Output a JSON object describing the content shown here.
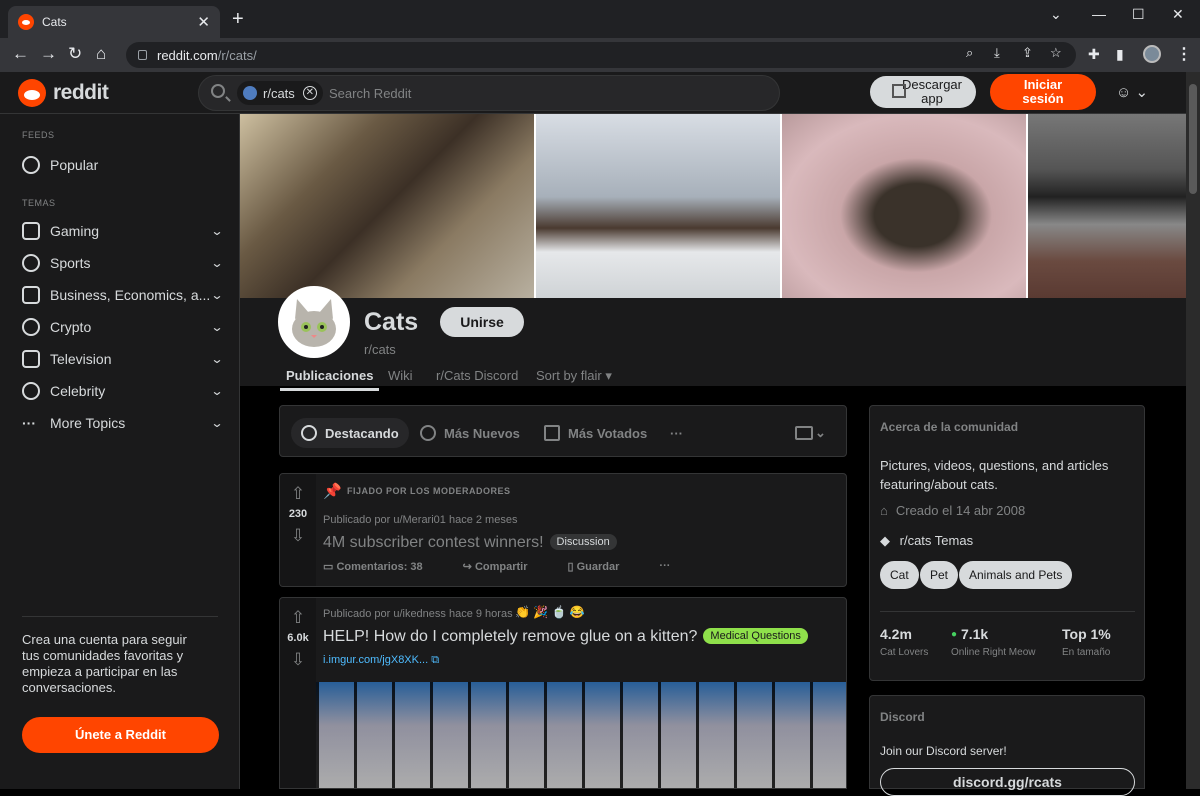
{
  "browser": {
    "tab_title": "Cats",
    "url_host": "reddit.com",
    "url_path": "/r/cats/"
  },
  "header": {
    "logo_text": "reddit",
    "search_chip": "r/cats",
    "search_placeholder": "Search Reddit",
    "download_line1": "Descargar",
    "download_line2": "app",
    "login_line1": "Iniciar",
    "login_line2": "sesión"
  },
  "sidebar": {
    "feeds_label": "FEEDS",
    "popular": "Popular",
    "topics_label": "TEMAS",
    "items": [
      {
        "label": "Gaming",
        "icon": "gamepad-icon"
      },
      {
        "label": "Sports",
        "icon": "ball-icon"
      },
      {
        "label": "Business, Economics, a...",
        "icon": "chart-icon"
      },
      {
        "label": "Crypto",
        "icon": "crypto-icon"
      },
      {
        "label": "Television",
        "icon": "tv-icon"
      },
      {
        "label": "Celebrity",
        "icon": "star-icon"
      },
      {
        "label": "More Topics",
        "icon": "more-icon"
      }
    ],
    "cta_text": "Crea una cuenta para seguir tus comunidades favoritas y empieza a participar en las conversaciones.",
    "join_button": "Únete a Reddit"
  },
  "community": {
    "name": "Cats",
    "sub": "r/cats",
    "join": "Unirse",
    "tabs": [
      "Publicaciones",
      "Wiki",
      "r/Cats Discord",
      "Sort by flair"
    ]
  },
  "sort": {
    "hot": "Destacando",
    "new": "Más Nuevos",
    "top": "Más Votados",
    "more": "···"
  },
  "posts": [
    {
      "pinned": "FIJADO POR LOS MODERADORES",
      "votes": "230",
      "meta": "Publicado por  u/Merari01 hace 2 meses",
      "title": "4M subscriber contest winners!",
      "flair": "Discussion",
      "comments": "Comentarios: 38",
      "share": "Compartir",
      "save": "Guardar"
    },
    {
      "votes": "6.0k",
      "meta": "Publicado por  u/ikedness hace 9 horas",
      "title": "HELP! How do I completely remove glue on a kitten?",
      "flair": "Medical Questions",
      "link": "i.imgur.com/jgX8XK..."
    }
  ],
  "about": {
    "heading": "Acerca de la comunidad",
    "description": "Pictures, videos, questions, and articles featuring/about cats.",
    "created": "Creado el 14 abr 2008",
    "topics_label": "r/cats Temas",
    "chips": [
      "Cat",
      "Pet",
      "Animals and Pets"
    ],
    "stats": [
      {
        "value": "4.2m",
        "label": "Cat Lovers"
      },
      {
        "value": "7.1k",
        "label": "Online Right Meow"
      },
      {
        "value": "Top 1%",
        "label": "En tamaño"
      }
    ]
  },
  "discord": {
    "heading": "Discord",
    "text": "Join our Discord server!",
    "button": "discord.gg/rcats"
  },
  "colors": {
    "accent": "#ff4500",
    "flair_medical": "#8fe04b",
    "online": "#46d160"
  }
}
